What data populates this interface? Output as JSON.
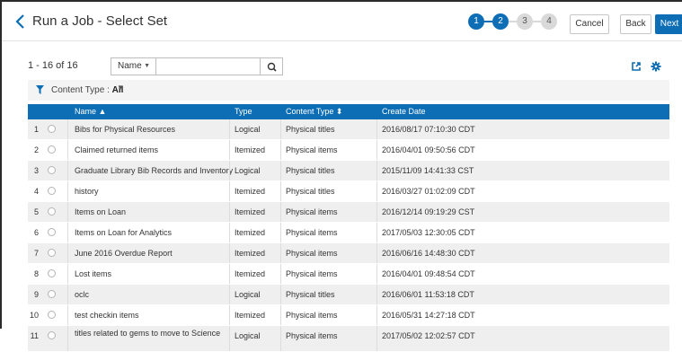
{
  "header": {
    "title": "Run a Job - Select Set",
    "steps": [
      "1",
      "2",
      "3",
      "4"
    ],
    "cancel_label": "Cancel",
    "back_label": "Back",
    "next_label": "Next",
    "accent_color": "#0d6eb5"
  },
  "toolbar": {
    "count_label": "1 - 16 of 16",
    "search_field_selected": "Name",
    "search_value": ""
  },
  "filter": {
    "label": "Content Type : ",
    "value": "All"
  },
  "table": {
    "columns": [
      "Name ▲",
      "Type",
      "Content Type ⬍",
      "Create Date"
    ],
    "rows": [
      {
        "n": "1",
        "name": "Bibs for Physical Resources",
        "type": "Logical",
        "content": "Physical titles",
        "date": "2016/08/17 07:10:30 CDT"
      },
      {
        "n": "2",
        "name": "Claimed returned items",
        "type": "Itemized",
        "content": "Physical items",
        "date": "2016/04/01 09:50:56 CDT"
      },
      {
        "n": "3",
        "name": "Graduate Library Bib Records and Inventory",
        "type": "Logical",
        "content": "Physical titles",
        "date": "2015/11/09 14:41:33 CST"
      },
      {
        "n": "4",
        "name": "history",
        "type": "Itemized",
        "content": "Physical titles",
        "date": "2016/03/27 01:02:09 CDT"
      },
      {
        "n": "5",
        "name": "Items on Loan",
        "type": "Itemized",
        "content": "Physical items",
        "date": "2016/12/14 09:19:29 CST"
      },
      {
        "n": "6",
        "name": "Items on Loan for Analytics",
        "type": "Itemized",
        "content": "Physical items",
        "date": "2017/05/03 12:30:05 CDT"
      },
      {
        "n": "7",
        "name": "June 2016 Overdue Report",
        "type": "Itemized",
        "content": "Physical items",
        "date": "2016/06/16 14:48:30 CDT"
      },
      {
        "n": "8",
        "name": "Lost items",
        "type": "Itemized",
        "content": "Physical items",
        "date": "2016/04/01 09:48:54 CDT"
      },
      {
        "n": "9",
        "name": "oclc",
        "type": "Logical",
        "content": "Physical titles",
        "date": "2016/06/01 11:53:18 CDT"
      },
      {
        "n": "10",
        "name": "test checkin items",
        "type": "Itemized",
        "content": "Physical items",
        "date": "2016/05/31 14:27:18 CDT"
      },
      {
        "n": "11",
        "name": "titles related to gems to move to Science",
        "type": "Logical",
        "content": "Physical items",
        "date": "2017/05/02 12:02:57 CDT"
      }
    ]
  }
}
